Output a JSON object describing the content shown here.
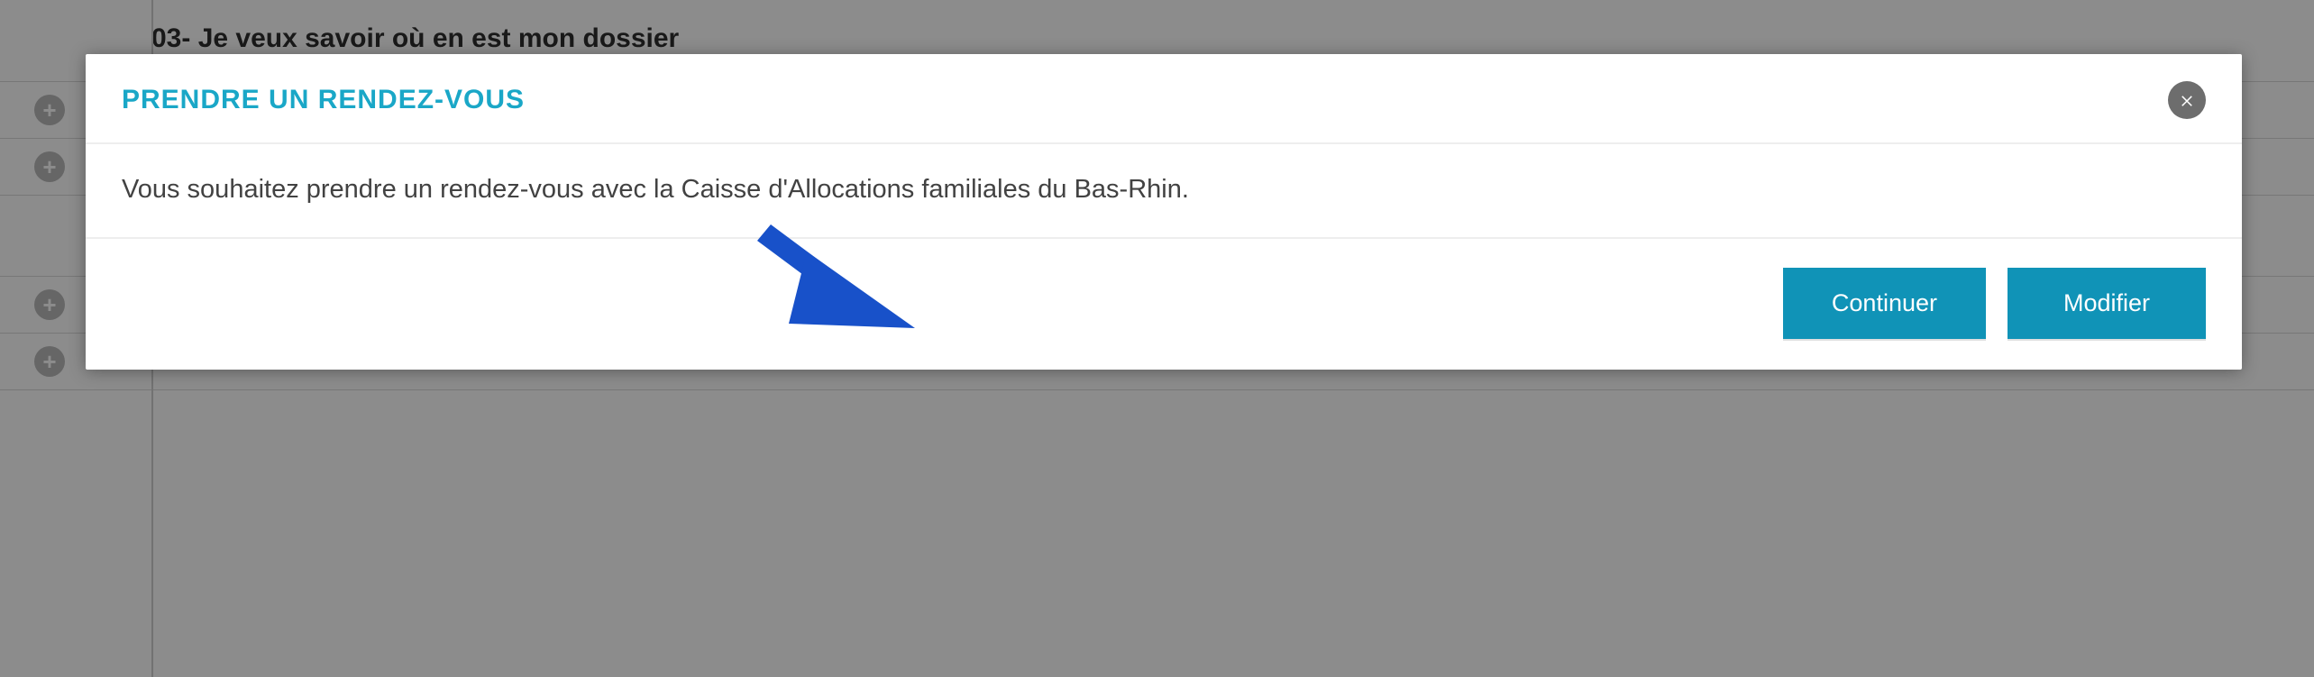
{
  "background": {
    "heading": "03- Je veux savoir où en est mon dossier"
  },
  "modal": {
    "title": "PRENDRE UN RENDEZ-VOUS",
    "body": "Vous souhaitez prendre un rendez-vous avec la Caisse d'Allocations familiales du Bas-Rhin.",
    "buttons": {
      "continue": "Continuer",
      "modify": "Modifier"
    }
  },
  "colors": {
    "accent": "#1aa7c7",
    "buttonBg": "#1093b7",
    "arrow": "#1851c9"
  }
}
